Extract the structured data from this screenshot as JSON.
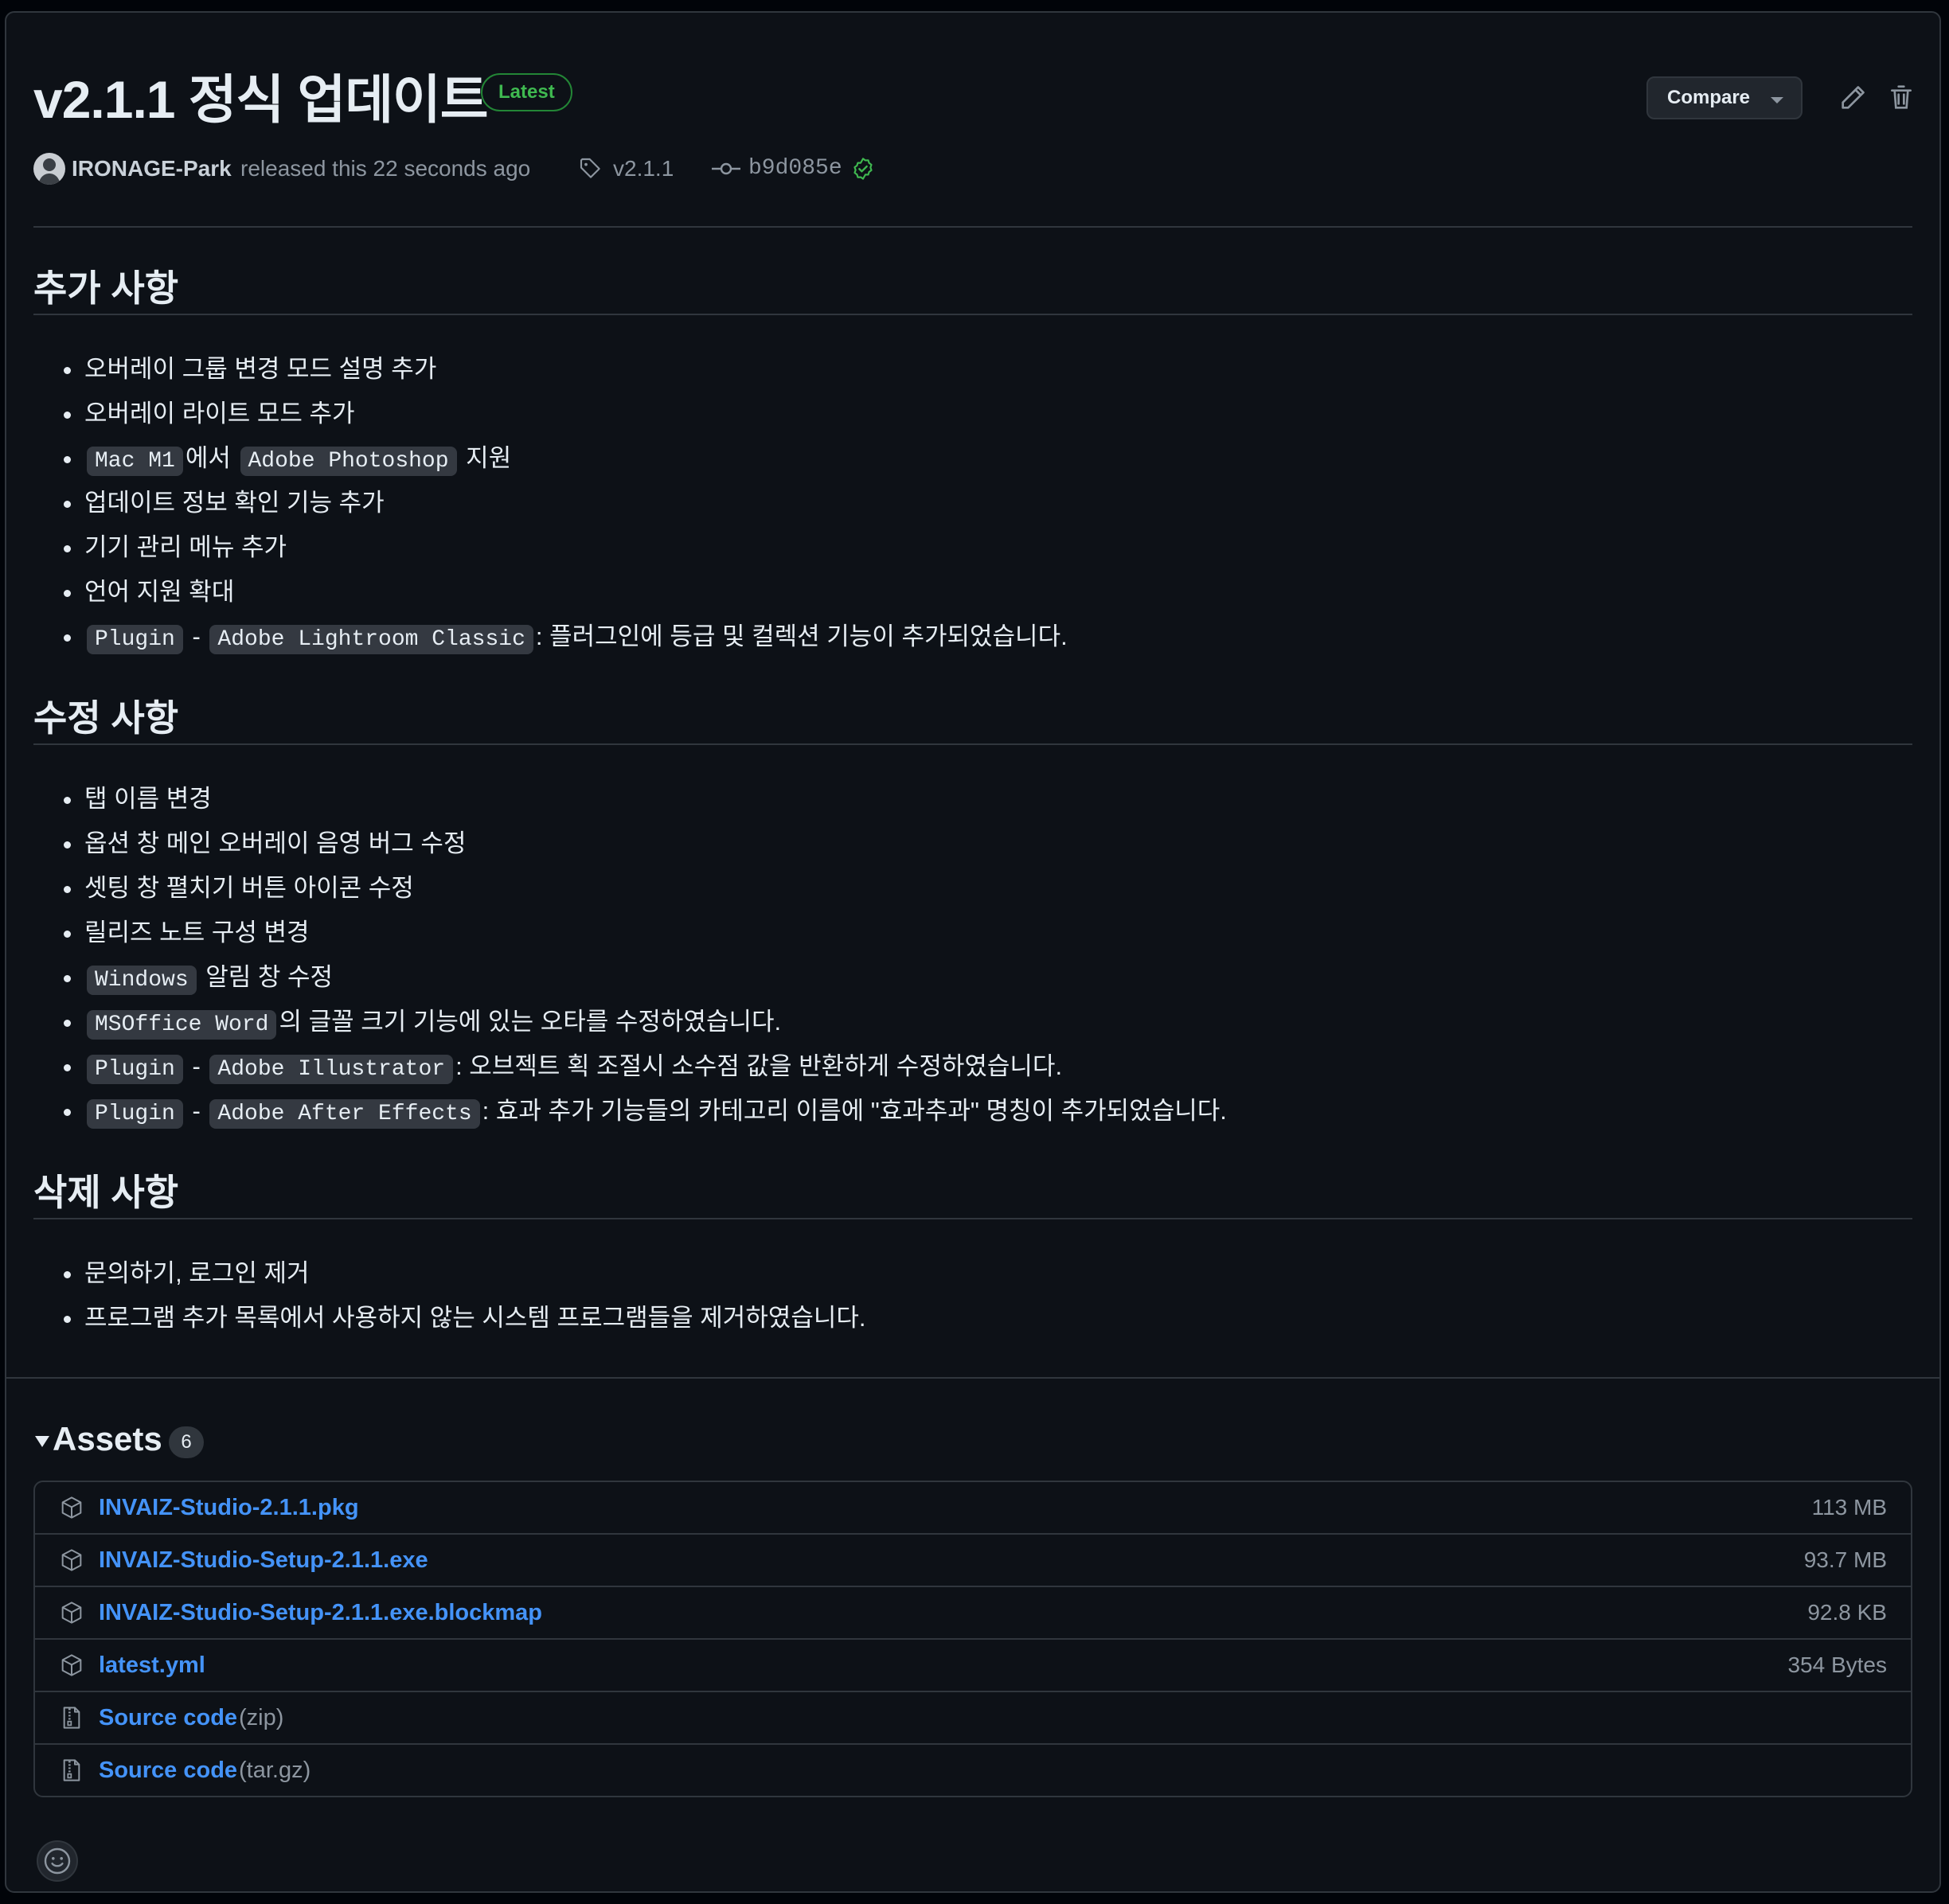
{
  "release": {
    "title": "v2.1.1 정식 업데이트",
    "badge": "Latest",
    "compare_label": "Compare",
    "author": "IRONAGE-Park",
    "released_text": "released this 22 seconds ago",
    "tag": "v2.1.1",
    "commit": "b9d085e"
  },
  "sections": {
    "added": {
      "heading": "추가 사항",
      "items": {
        "i0": "오버레이 그룹 변경 모드 설명 추가",
        "i1": "오버레이 라이트 모드 추가",
        "i2": {
          "code1": "Mac M1",
          "t1": "에서",
          "code2": "Adobe Photoshop",
          "t2": "지원"
        },
        "i3": "업데이트 정보 확인 기능 추가",
        "i4": "기기 관리 메뉴 추가",
        "i5": "언어 지원 확대",
        "i6": {
          "code1": "Plugin",
          "sep": "-",
          "code2": "Adobe Lightroom Classic",
          "t": ": 플러그인에 등급 및 컬렉션 기능이 추가되었습니다."
        }
      }
    },
    "fixed": {
      "heading": "수정 사항",
      "items": {
        "i0": "탭 이름 변경",
        "i1": "옵션 창 메인 오버레이 음영 버그 수정",
        "i2": "셋팅 창 펼치기 버튼 아이콘 수정",
        "i3": "릴리즈 노트 구성 변경",
        "i4": {
          "code1": "Windows",
          "t": "알림 창 수정"
        },
        "i5": {
          "code1": "MSOffice Word",
          "t": "의 글꼴 크기 기능에 있는 오타를 수정하였습니다."
        },
        "i6": {
          "code1": "Plugin",
          "sep": "-",
          "code2": "Adobe Illustrator",
          "t": ": 오브젝트 획 조절시 소수점 값을 반환하게 수정하였습니다."
        },
        "i7": {
          "code1": "Plugin",
          "sep": "-",
          "code2": "Adobe After Effects",
          "t": ": 효과 추가 기능들의 카테고리 이름에 \"효과추과\" 명칭이 추가되었습니다."
        }
      }
    },
    "removed": {
      "heading": "삭제 사항",
      "items": {
        "i0": "문의하기, 로그인 제거",
        "i1": "프로그램 추가 목록에서 사용하지 않는 시스템 프로그램들을 제거하였습니다."
      }
    }
  },
  "assets": {
    "label": "Assets",
    "count": "6",
    "rows": [
      {
        "name": "INVAIZ-Studio-2.1.1.pkg",
        "size": "113 MB",
        "icon": "package-icon"
      },
      {
        "name": "INVAIZ-Studio-Setup-2.1.1.exe",
        "size": "93.7 MB",
        "icon": "package-icon"
      },
      {
        "name": "INVAIZ-Studio-Setup-2.1.1.exe.blockmap",
        "size": "92.8 KB",
        "icon": "package-icon"
      },
      {
        "name": "latest.yml",
        "size": "354 Bytes",
        "icon": "package-icon"
      },
      {
        "name": "Source code",
        "suffix": "(zip)",
        "icon": "file-zip-icon"
      },
      {
        "name": "Source code",
        "suffix": "(tar.gz)",
        "icon": "file-zip-icon"
      }
    ]
  },
  "colors": {
    "background": "#0d1117",
    "border": "#30363d",
    "link": "#4493f8",
    "badge_green": "#3fb950"
  }
}
